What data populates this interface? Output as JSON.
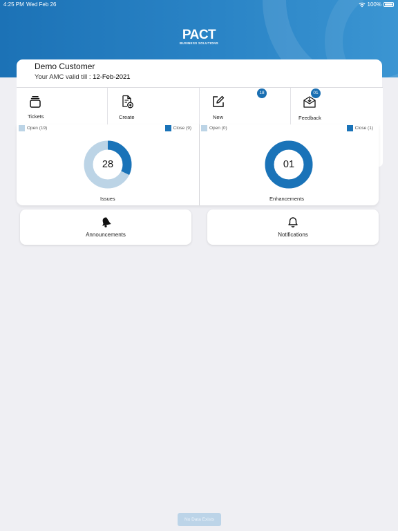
{
  "status_bar": {
    "time": "4:25 PM",
    "date": "Wed Feb 26",
    "battery": "100%"
  },
  "logo": {
    "main": "PACT",
    "sub": "BUSINESS SOLUTIONS"
  },
  "customer": {
    "name": "Demo Customer",
    "amc_prefix": "Your AMC valid till : ",
    "amc_date": "12-Feb-2021"
  },
  "tabs": [
    {
      "label": "Tickets",
      "icon": "stack-icon",
      "badge": ""
    },
    {
      "label": "Create",
      "icon": "document-add-icon",
      "badge": ""
    },
    {
      "label": "New",
      "icon": "edit-icon",
      "badge": "18"
    },
    {
      "label": "Feedback",
      "icon": "mail-download-icon",
      "badge": "01"
    }
  ],
  "chart_data": [
    {
      "type": "pie",
      "title": "Issues",
      "categories": [
        "Open",
        "Close"
      ],
      "values": [
        19,
        9
      ],
      "legend": [
        "Open (19)",
        "Close (9)"
      ],
      "center_label": "28",
      "colors": {
        "Open": "#bcd4e6",
        "Close": "#1a73b8"
      }
    },
    {
      "type": "pie",
      "title": "Enhancements",
      "categories": [
        "Open",
        "Close"
      ],
      "values": [
        0,
        1
      ],
      "legend": [
        "Open (0)",
        "Close (1)"
      ],
      "center_label": "01",
      "colors": {
        "Open": "#bcd4e6",
        "Close": "#1a73b8"
      }
    }
  ],
  "actions": [
    {
      "label": "Announcements",
      "icon": "bell-filled-icon"
    },
    {
      "label": "Notifications",
      "icon": "bell-outline-icon"
    }
  ],
  "footer": {
    "no_data": "No Data Exists"
  },
  "colors": {
    "header": "#2a84c6",
    "accent": "#1a6fb2",
    "light": "#bcd4e6",
    "background": "#efeff3"
  }
}
